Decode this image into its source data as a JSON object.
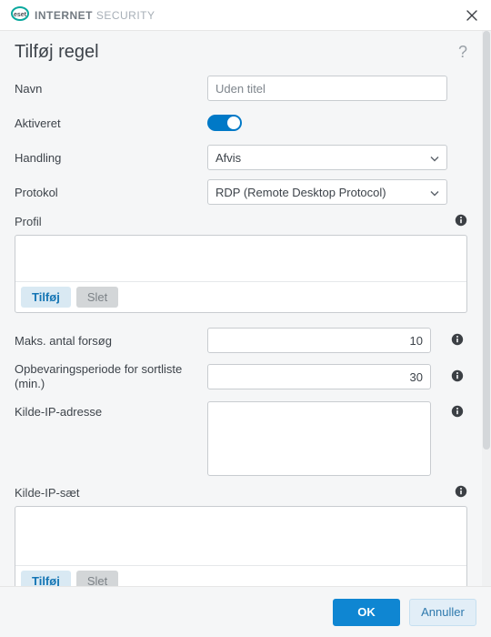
{
  "brand": {
    "logoAlt": "eset-logo",
    "strong": "INTERNET",
    "thin": "SECURITY"
  },
  "heading": "Tilføj regel",
  "labels": {
    "name": "Navn",
    "enabled": "Aktiveret",
    "action": "Handling",
    "protocol": "Protokol",
    "profile": "Profil",
    "maxAttempts": "Maks. antal forsøg",
    "blacklistRetention": "Opbevaringsperiode for sortliste (min.)",
    "sourceIp": "Kilde-IP-adresse",
    "sourceIpSet": "Kilde-IP-sæt"
  },
  "fields": {
    "namePlaceholder": "Uden titel",
    "actionValue": "Afvis",
    "protocolValue": "RDP (Remote Desktop Protocol)",
    "maxAttemptsValue": "10",
    "blacklistRetentionValue": "30"
  },
  "buttons": {
    "add": "Tilføj",
    "delete": "Slet",
    "ok": "OK",
    "cancel": "Annuller"
  }
}
